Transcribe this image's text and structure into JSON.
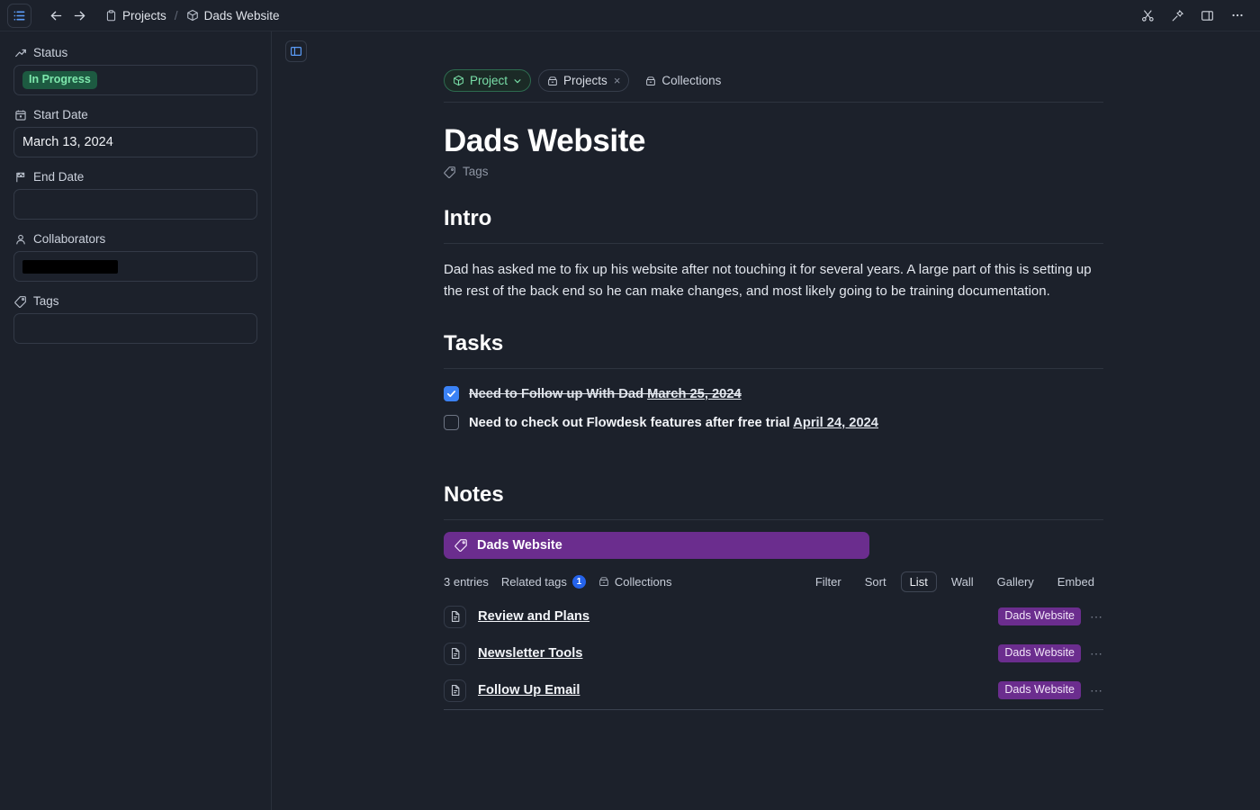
{
  "topbar": {
    "menu_icon": "list-icon",
    "back_icon": "arrow-left-icon",
    "forward_icon": "arrow-right-icon",
    "breadcrumb": [
      {
        "label": "Projects",
        "icon": "clipboard-icon"
      },
      {
        "label": "Dads Website",
        "icon": "box-icon"
      }
    ],
    "separator": "/",
    "right_icons": [
      "scissors-icon",
      "pin-icon",
      "panel-right-icon",
      "more-horizontal-icon"
    ]
  },
  "sidebar": {
    "fields": [
      {
        "label": "Status",
        "icon": "trending-up-icon",
        "type": "badge",
        "value": "In Progress"
      },
      {
        "label": "Start Date",
        "icon": "calendar-icon",
        "type": "text",
        "value": "March 13, 2024"
      },
      {
        "label": "End Date",
        "icon": "flag-checkered-icon",
        "type": "text",
        "value": ""
      },
      {
        "label": "Collaborators",
        "icon": "user-icon",
        "type": "redacted",
        "value": ""
      },
      {
        "label": "Tags",
        "icon": "tag-icon",
        "type": "text",
        "value": ""
      }
    ]
  },
  "main": {
    "panel_toggle_icon": "panel-left-icon",
    "chips": [
      {
        "label": "Project",
        "icon": "box-icon",
        "style": "green",
        "chevron": "⌄"
      },
      {
        "label": "Projects",
        "icon": "archive-icon",
        "style": "outline",
        "close": "×"
      },
      {
        "label": "Collections",
        "icon": "archive-icon",
        "style": "plain"
      }
    ],
    "title": "Dads Website",
    "tags_placeholder": "Tags",
    "sections": [
      {
        "heading": "Intro",
        "paragraph": "Dad has asked me to fix up his website after not touching it for several years. A large part of this is setting up the rest of the back end so he can make changes, and most likely going to be training documentation."
      },
      {
        "heading": "Tasks"
      },
      {
        "heading": "Notes"
      }
    ],
    "tasks": [
      {
        "text": "Need to Follow up With Dad",
        "date": "March 25, 2024",
        "done": true
      },
      {
        "text": "Need to check out Flowdesk features after free trial",
        "date": "April 24, 2024",
        "done": false
      }
    ],
    "note_banner": {
      "label": "Dads Website",
      "icon": "tag-icon",
      "color": "#6b2d8e"
    },
    "list_toolbar": {
      "entry_count": "3 entries",
      "related_tags_label": "Related tags",
      "related_tags_count": "1",
      "collections_label": "Collections",
      "collections_icon": "archive-icon",
      "filter_label": "Filter",
      "sort_label": "Sort",
      "views": [
        {
          "label": "List",
          "active": true
        },
        {
          "label": "Wall",
          "active": false
        },
        {
          "label": "Gallery",
          "active": false
        },
        {
          "label": "Embed",
          "active": false
        }
      ]
    },
    "entries": [
      {
        "title": "Review and Plans",
        "icon": "file-text-icon",
        "tag": "Dads Website",
        "menu": "⋯"
      },
      {
        "title": "Newsletter Tools",
        "icon": "file-text-icon",
        "tag": "Dads Website",
        "menu": "⋯"
      },
      {
        "title": "Follow Up Email",
        "icon": "file-text-icon",
        "tag": "Dads Website",
        "menu": "⋯"
      }
    ]
  },
  "colors": {
    "background": "#1c212b",
    "accent_blue": "#3b82f6",
    "status_green_bg": "#1d5a41",
    "status_green_text": "#7ee8ad",
    "tag_purple": "#6b2d8e"
  }
}
